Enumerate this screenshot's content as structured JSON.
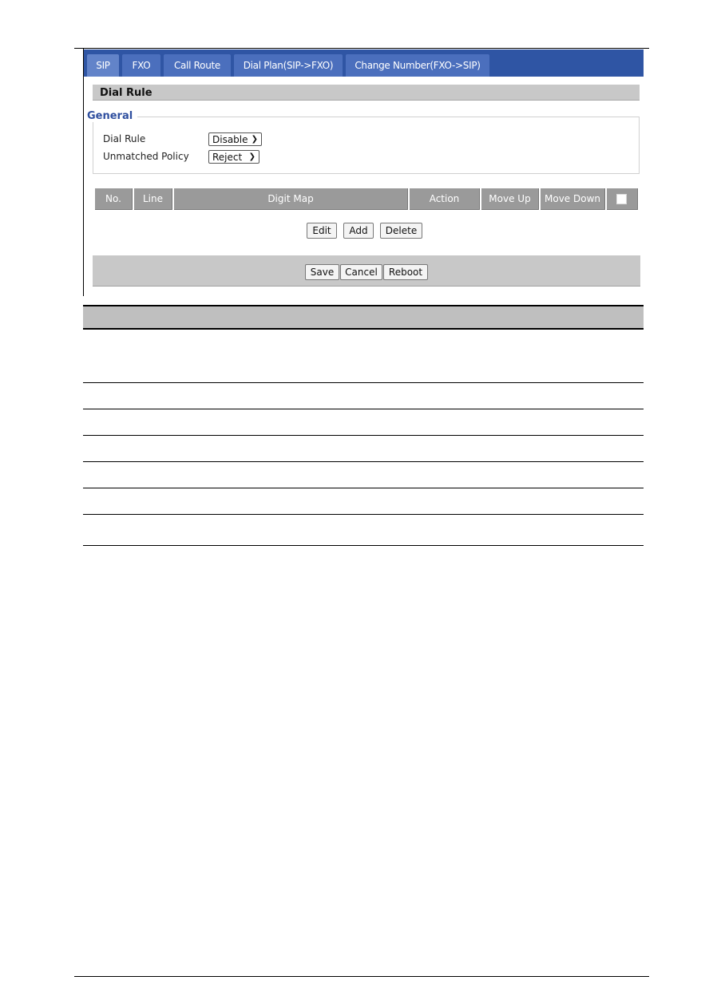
{
  "tabs": [
    {
      "label": "SIP",
      "active": true
    },
    {
      "label": "FXO",
      "active": false
    },
    {
      "label": "Call Route",
      "active": false
    },
    {
      "label": "Dial Plan(SIP->FXO)",
      "active": false
    },
    {
      "label": "Change Number(FXO->SIP)",
      "active": false
    }
  ],
  "section": {
    "title": "Dial Rule"
  },
  "general": {
    "legend": "General",
    "fields": [
      {
        "label": "Dial Rule",
        "value": "Disable"
      },
      {
        "label": "Unmatched Policy",
        "value": "Reject"
      }
    ]
  },
  "table": {
    "columns": [
      "No.",
      "Line",
      "Digit Map",
      "Action",
      "Move Up",
      "Move Down"
    ],
    "select_all_checked": false,
    "rows": []
  },
  "table_actions": {
    "edit": "Edit",
    "add": "Add",
    "delete": "Delete"
  },
  "footer": {
    "save": "Save",
    "cancel": "Cancel",
    "reboot": "Reboot"
  },
  "icons": {
    "dropdown": "chevron-down-icon",
    "select_all": "checkbox-icon"
  }
}
